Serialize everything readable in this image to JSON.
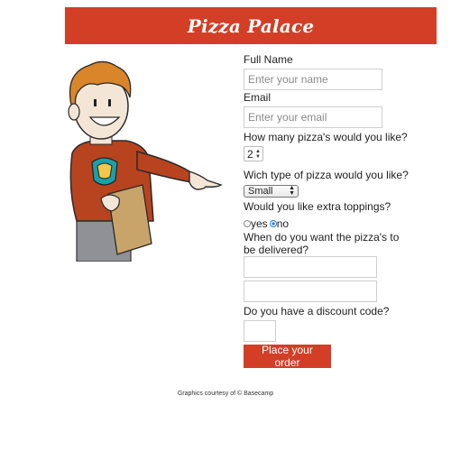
{
  "header": {
    "title": "Pizza Palace"
  },
  "form": {
    "full_name_label": "Full Name",
    "full_name_placeholder": "Enter your name",
    "email_label": "Email",
    "email_placeholder": "Enter your email",
    "quantity_label": "How many pizza's would you like?",
    "quantity_value": "2",
    "type_label": "Wich type of pizza would you like?",
    "type_selected": "Small",
    "toppings_label": "Would you like extra toppings?",
    "toppings_yes": "yes",
    "toppings_no": "no",
    "toppings_selected": "no",
    "delivery_label": "When do you want the pizza's to be delivered?",
    "discount_label": "Do you have a discount code?",
    "submit_label": "Place your order"
  },
  "footer": {
    "credit": "Graphics courtesy of © Basecamp"
  },
  "colors": {
    "brand": "#d23f26"
  },
  "illustration": {
    "icon": "pointing-man-holding-menu"
  }
}
